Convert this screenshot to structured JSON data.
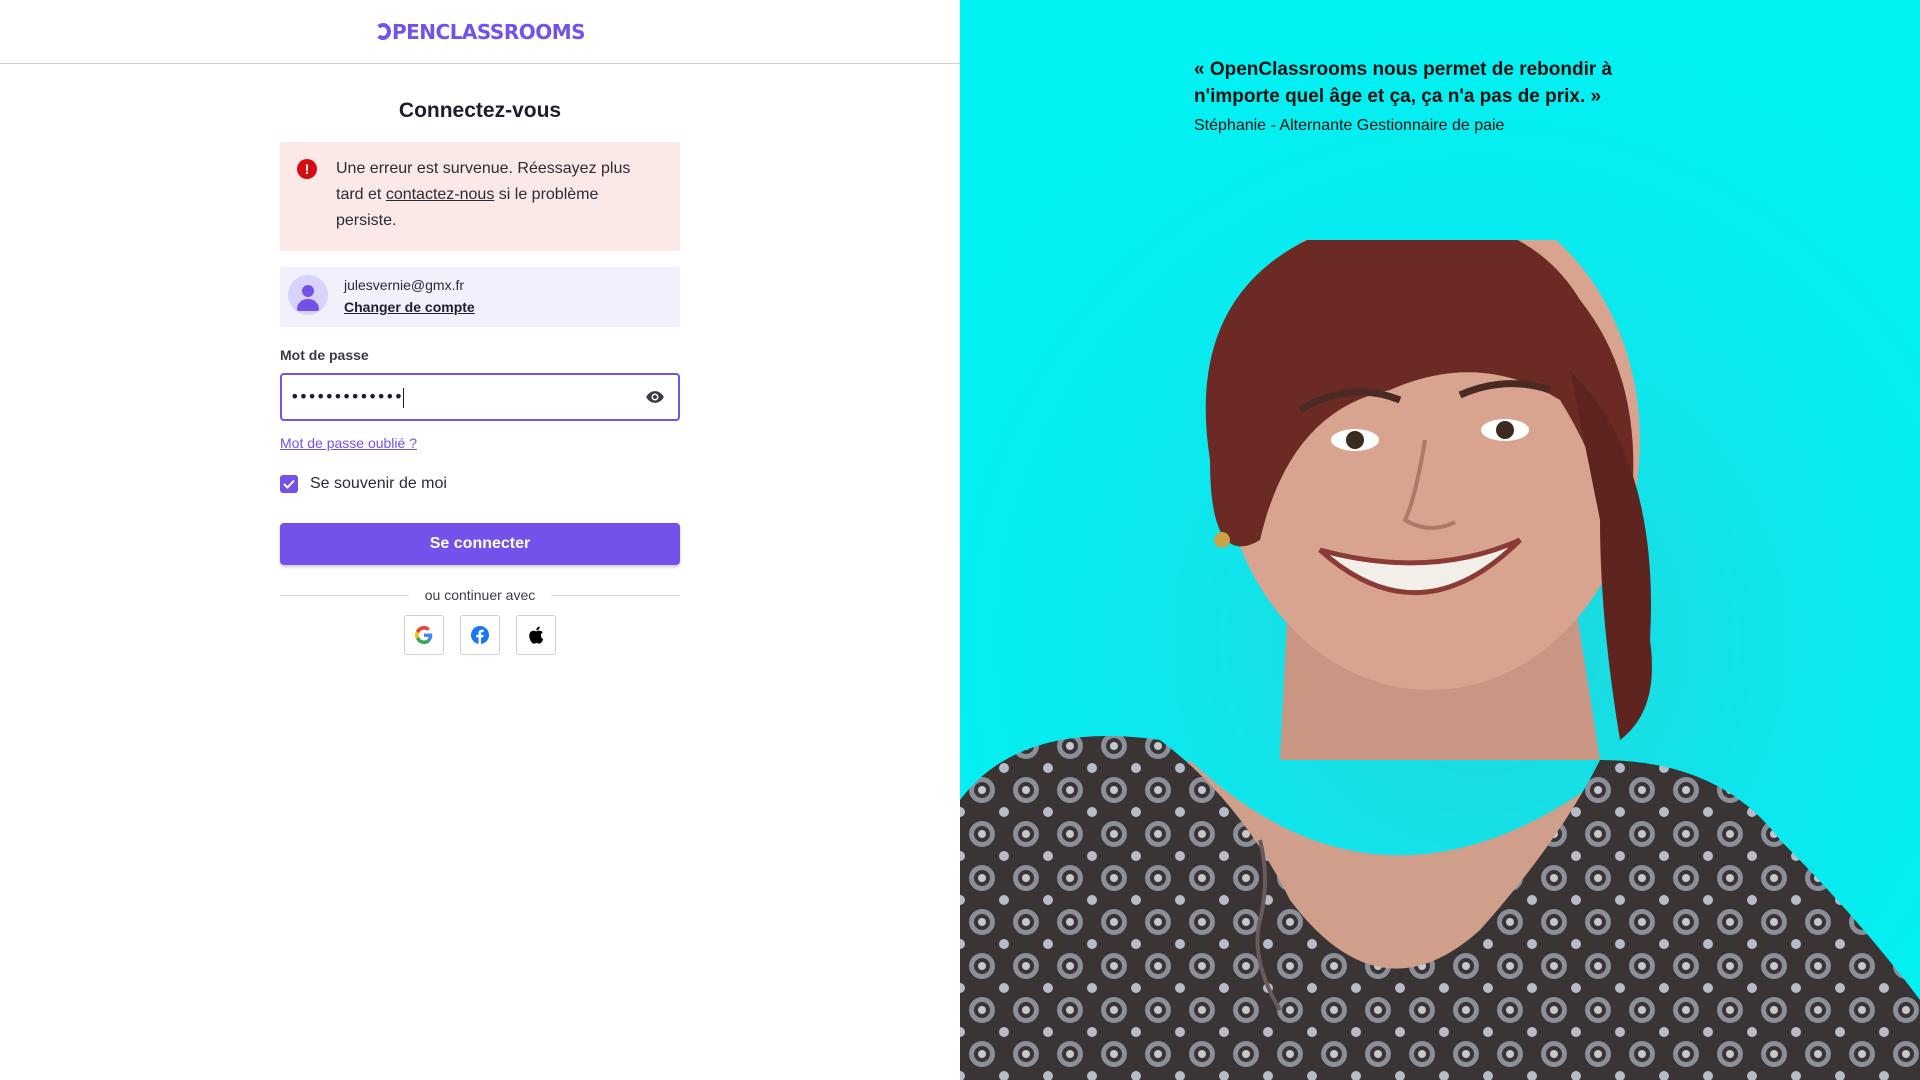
{
  "brand": {
    "logo_text": "PENCLASSROOMS",
    "accent_color": "#7451eb"
  },
  "login": {
    "title": "Connectez-vous",
    "error": {
      "icon": "alert-circle-icon",
      "text_before": "Une erreur est survenue. Réessayez plus tard et ",
      "link": "contactez-nous",
      "text_after": " si le problème persiste.",
      "color": "#d40d12"
    },
    "account": {
      "email": "julesvernie@gmx.fr",
      "change_label": "Changer de compte"
    },
    "password": {
      "label": "Mot de passe",
      "value": "•••••••••••••",
      "toggle_icon": "eye-icon"
    },
    "forgot_label": "Mot de passe oublié ?",
    "remember": {
      "label": "Se souvenir de moi",
      "checked": true
    },
    "submit_label": "Se connecter",
    "divider_text": "ou continuer avec",
    "socials": [
      "google-icon",
      "facebook-icon",
      "apple-icon"
    ]
  },
  "testimonial": {
    "quote": "« OpenClassrooms nous permet de rebondir à n'importe quel âge et ça, ça n'a pas de prix. »",
    "author": "Stéphanie - Alternante Gestionnaire de paie",
    "background_color": "#00f2f2"
  }
}
